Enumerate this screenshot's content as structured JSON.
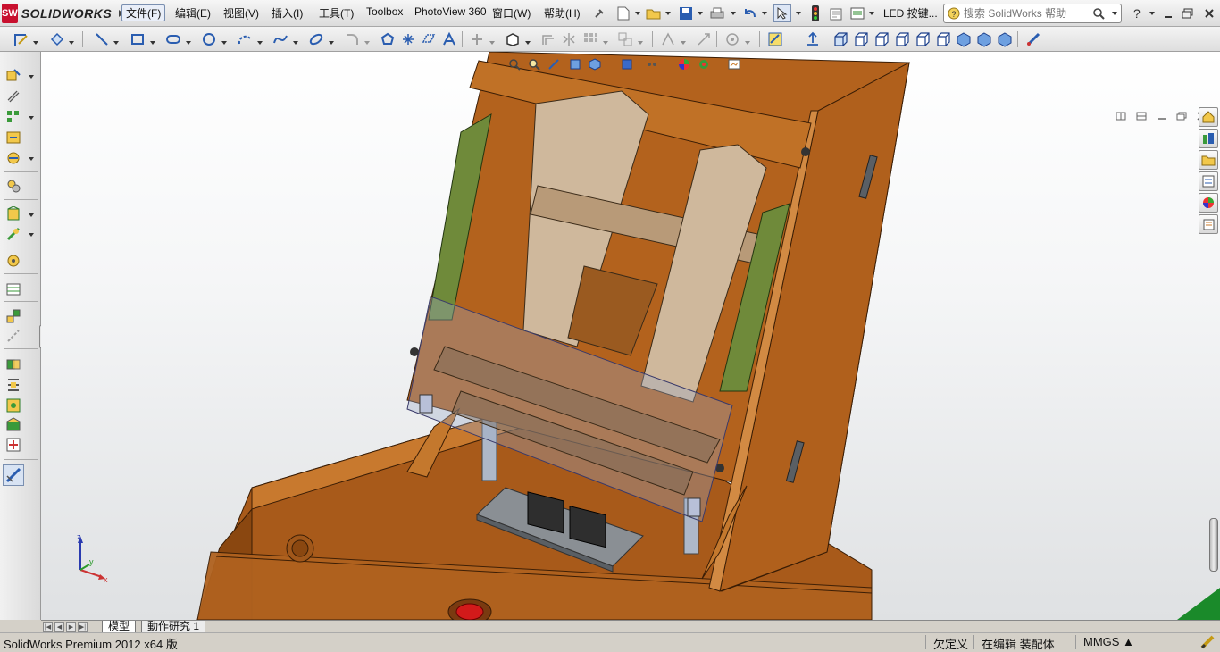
{
  "app": {
    "logo_text": "SOLIDWORKS",
    "logo_mark": "SW"
  },
  "menu": {
    "items": [
      "文件(F)",
      "编辑(E)",
      "视图(V)",
      "插入(I)",
      "工具(T)",
      "Toolbox",
      "PhotoView 360",
      "窗口(W)",
      "帮助(H)"
    ]
  },
  "toolbar": {
    "led_label": "LED 按键...",
    "search_placeholder": "搜索 SolidWorks 帮助"
  },
  "tabs": {
    "model": "模型",
    "motion": "動作研究 1"
  },
  "status": {
    "product": "SolidWorks Premium 2012 x64 版",
    "underdefined": "欠定义",
    "editing": "在编辑 装配体",
    "units": "MMGS ▲"
  },
  "triad": {
    "x": "x",
    "y": "y",
    "z": "z"
  },
  "colors": {
    "accent": "#c8102e",
    "wood": "#b0611c",
    "wood_dark": "#8a4a12",
    "rail_green": "#6f8a3a"
  }
}
